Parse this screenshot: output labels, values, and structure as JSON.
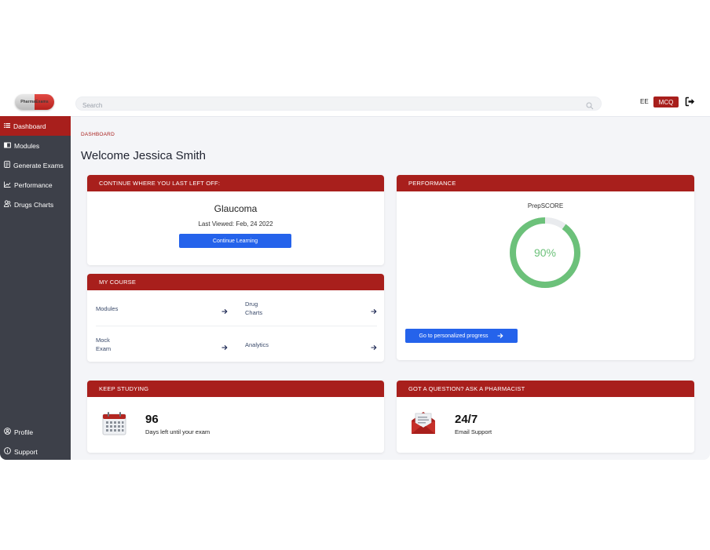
{
  "logo": {
    "text": "PharmaExams"
  },
  "header": {
    "search_placeholder": "Search",
    "user_initials": "EE",
    "mcq_label": "MCQ"
  },
  "sidebar": {
    "items": [
      {
        "label": "Dashboard",
        "icon": "list-icon",
        "active": true
      },
      {
        "label": "Modules",
        "icon": "book-icon",
        "active": false
      },
      {
        "label": "Generate Exams",
        "icon": "exam-icon",
        "active": false
      },
      {
        "label": "Performance",
        "icon": "chart-line-icon",
        "active": false
      },
      {
        "label": "Drugs Charts",
        "icon": "people-icon",
        "active": false
      }
    ],
    "bottom_items": [
      {
        "label": "Profile",
        "icon": "user-circle-icon"
      },
      {
        "label": "Support",
        "icon": "info-circle-icon"
      }
    ]
  },
  "main": {
    "breadcrumb": "DASHBOARD",
    "welcome": "Welcome Jessica Smith",
    "continue_card": {
      "header": "CONTINUE WHERE YOU LAST LEFT OFF:",
      "title": "Glaucoma",
      "last_viewed": "Last Viewed: Feb, 24 2022",
      "button": "Continue Learning"
    },
    "course_card": {
      "header": "MY COURSE",
      "items": [
        {
          "label": "Modules"
        },
        {
          "label": "Drug Charts"
        },
        {
          "label": "Mock Exam"
        },
        {
          "label": "Analytics"
        }
      ]
    },
    "performance_card": {
      "header": "PERFORMANCE",
      "title": "PrepSCORE",
      "score_label": "90%",
      "score_value": 0.9,
      "ring_color": "#6cc17a",
      "track_color": "#e9ebee",
      "button": "Go to personalized progress"
    },
    "study_card": {
      "header": "KEEP STUDYING",
      "value": "96",
      "caption": "Days left until your exam"
    },
    "question_card": {
      "header": "GOT A QUESTION? ASK A PHARMACIST",
      "value": "24/7",
      "caption": "Email Support"
    }
  },
  "colors": {
    "brand": "#a81f1c",
    "accent": "#2563eb",
    "sidebar": "#3d4049"
  }
}
